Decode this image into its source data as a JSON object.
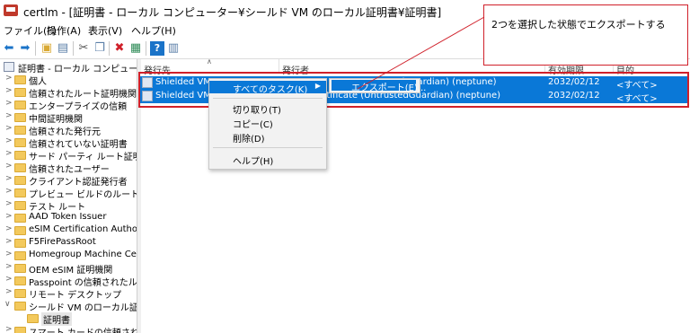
{
  "window": {
    "title": "certlm - [証明書 - ローカル コンピューター¥シールド VM のローカル証明書¥証明書]"
  },
  "menu": [
    "ファイル(F)",
    "操作(A)",
    "表示(V)",
    "ヘルプ(H)"
  ],
  "toolbar": {
    "icons": [
      "back-arrow-icon",
      "forward-arrow-icon",
      "folder-up-icon",
      "properties-icon",
      "cut-icon",
      "copy-icon",
      "delete-icon",
      "export-icon",
      "help-icon",
      "details-icon"
    ]
  },
  "tree": {
    "root": "証明書 - ローカル コンピューター",
    "items": [
      "個人",
      "信頼されたルート証明機関",
      "エンタープライズの信頼",
      "中間証明機関",
      "信頼された発行元",
      "信頼されていない証明書",
      "サード パーティ ルート証明機関",
      "信頼されたユーザー",
      "クライアント認証発行者",
      "プレビュー ビルドのルート",
      "テスト ルート",
      "AAD Token Issuer",
      "eSIM Certification Authorities",
      "F5FirePassRoot",
      "Homegroup Machine Certific",
      "OEM eSIM 証明機関",
      "Passpoint の信頼されたルート",
      "リモート デスクトップ",
      "シールド VM のローカル証明書"
    ],
    "child": "証明書",
    "last": "スマート カードの信頼されたルート"
  },
  "list": {
    "columns": [
      "発行先",
      "発行者",
      "有効期限",
      "目的"
    ],
    "rows": [
      {
        "issued_to": "Shielded VM E",
        "issuer": "dGuardian) (neptune)",
        "expires": "2032/02/12",
        "purpose": "<すべて>"
      },
      {
        "issued_to": "Shielded VM S",
        "issuer": "igning Certificate (UntrustedGuardian) (neptune)",
        "expires": "2032/02/12",
        "purpose": "<すべて>"
      }
    ]
  },
  "context_menu": {
    "all_tasks": "すべてのタスク(K)",
    "cut": "切り取り(T)",
    "copy": "コピー(C)",
    "delete": "削除(D)",
    "help": "ヘルプ(H)"
  },
  "submenu": {
    "export": "エクスポート(E)..."
  },
  "callout": {
    "text": "2つを選択した状態でエクスポートする"
  },
  "colors": {
    "selection": "#0a78d7",
    "annotation": "#d0202a"
  }
}
